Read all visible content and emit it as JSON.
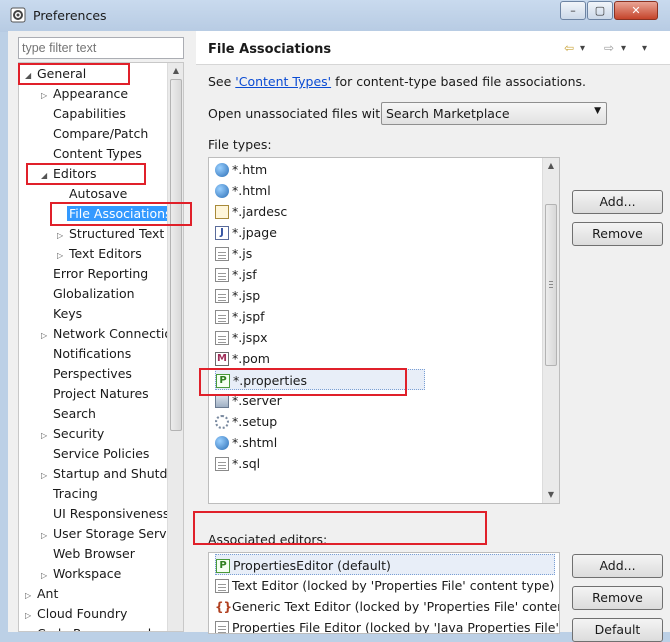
{
  "window": {
    "title": "Preferences",
    "minimize": "–",
    "maximize": "▢",
    "close": "✕"
  },
  "filter": {
    "placeholder": "type filter text"
  },
  "tree": [
    {
      "label": "General",
      "level": 0,
      "twisty": "◢"
    },
    {
      "label": "Appearance",
      "level": 1,
      "twisty": "▷"
    },
    {
      "label": "Capabilities",
      "level": 1,
      "twisty": ""
    },
    {
      "label": "Compare/Patch",
      "level": 1,
      "twisty": ""
    },
    {
      "label": "Content Types",
      "level": 1,
      "twisty": ""
    },
    {
      "label": "Editors",
      "level": 1,
      "twisty": "◢"
    },
    {
      "label": "Autosave",
      "level": 2,
      "twisty": ""
    },
    {
      "label": "File Associations",
      "level": 2,
      "twisty": "",
      "selected": true
    },
    {
      "label": "Structured Text E",
      "level": 2,
      "twisty": "▷"
    },
    {
      "label": "Text Editors",
      "level": 2,
      "twisty": "▷"
    },
    {
      "label": "Error Reporting",
      "level": 1,
      "twisty": ""
    },
    {
      "label": "Globalization",
      "level": 1,
      "twisty": ""
    },
    {
      "label": "Keys",
      "level": 1,
      "twisty": ""
    },
    {
      "label": "Network Connectio",
      "level": 1,
      "twisty": "▷"
    },
    {
      "label": "Notifications",
      "level": 1,
      "twisty": ""
    },
    {
      "label": "Perspectives",
      "level": 1,
      "twisty": ""
    },
    {
      "label": "Project Natures",
      "level": 1,
      "twisty": ""
    },
    {
      "label": "Search",
      "level": 1,
      "twisty": ""
    },
    {
      "label": "Security",
      "level": 1,
      "twisty": "▷"
    },
    {
      "label": "Service Policies",
      "level": 1,
      "twisty": ""
    },
    {
      "label": "Startup and Shutdo",
      "level": 1,
      "twisty": "▷"
    },
    {
      "label": "Tracing",
      "level": 1,
      "twisty": ""
    },
    {
      "label": "UI Responsiveness",
      "level": 1,
      "twisty": ""
    },
    {
      "label": "User Storage Servic",
      "level": 1,
      "twisty": "▷"
    },
    {
      "label": "Web Browser",
      "level": 1,
      "twisty": ""
    },
    {
      "label": "Workspace",
      "level": 1,
      "twisty": "▷"
    },
    {
      "label": "Ant",
      "level": 0,
      "twisty": "▷"
    },
    {
      "label": "Cloud Foundry",
      "level": 0,
      "twisty": "▷"
    },
    {
      "label": "Code Recommenders",
      "level": 0,
      "twisty": "▷"
    }
  ],
  "page": {
    "title": "File Associations",
    "nav": {
      "back": "⇦",
      "back_menu": "▾",
      "forward": "⇨",
      "forward_menu": "▾",
      "view_menu": "▾"
    },
    "see_prefix": "See ",
    "see_link": "'Content Types'",
    "see_suffix": " for content-type based file associations.",
    "open_label": "Open unassociated files with:",
    "open_value": "Search Marketplace",
    "file_types_label": "File types:",
    "associated_label": "Associated editors:"
  },
  "file_types": [
    {
      "name": "*.htm",
      "icon": "globe-icon"
    },
    {
      "name": "*.html",
      "icon": "globe-icon"
    },
    {
      "name": "*.jardesc",
      "icon": "jar-icon"
    },
    {
      "name": "*.jpage",
      "icon": "java-file-icon"
    },
    {
      "name": "*.js",
      "icon": "file-icon"
    },
    {
      "name": "*.jsf",
      "icon": "file-icon"
    },
    {
      "name": "*.jsp",
      "icon": "file-icon"
    },
    {
      "name": "*.jspf",
      "icon": "file-icon"
    },
    {
      "name": "*.jspx",
      "icon": "file-icon"
    },
    {
      "name": "*.pom",
      "icon": "maven-icon"
    },
    {
      "name": "*.properties",
      "icon": "properties-icon",
      "selected": true
    },
    {
      "name": "*.server",
      "icon": "server-icon"
    },
    {
      "name": "*.setup",
      "icon": "gear-icon"
    },
    {
      "name": "*.shtml",
      "icon": "globe-icon"
    },
    {
      "name": "*.sql",
      "icon": "file-icon"
    }
  ],
  "editors": [
    {
      "name": "PropertiesEditor (default)",
      "icon": "properties-icon",
      "selected": true
    },
    {
      "name": "Text Editor (locked by 'Properties File' content type) (loc",
      "icon": "file-icon"
    },
    {
      "name": "Generic Text Editor (locked by 'Properties File' content t",
      "icon": "generic-editor-icon"
    },
    {
      "name": "Properties File Editor (locked by 'Java Properties File' cc",
      "icon": "file-icon"
    }
  ],
  "buttons": {
    "types_add": "Add...",
    "types_remove": "Remove",
    "editors_add": "Add...",
    "editors_remove": "Remove",
    "editors_default": "Default"
  },
  "colors": {
    "highlight": "#e0202a",
    "selection": "#3399ff",
    "link": "#0a4bd3"
  }
}
